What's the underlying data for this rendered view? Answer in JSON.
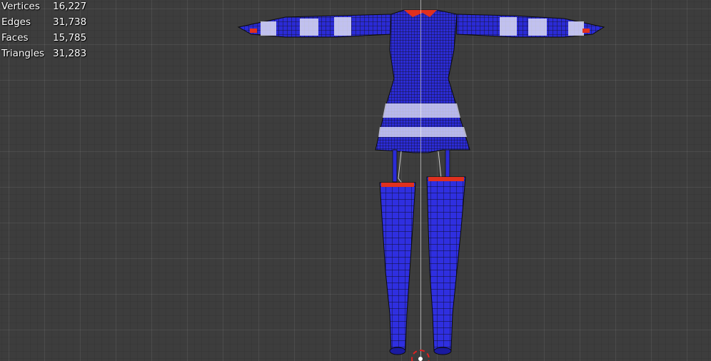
{
  "viewport": {
    "background_color": "#3d3d3d",
    "mesh_color": "#2a2ad8",
    "wire_color": "#111111",
    "highlight_color": "#dcdcf5",
    "accent_color": "#e0301e"
  },
  "statistics": [
    {
      "label": "Vertices",
      "value": "16,227"
    },
    {
      "label": "Edges",
      "value": "31,738"
    },
    {
      "label": "Faces",
      "value": "15,785"
    },
    {
      "label": "Triangles",
      "value": "31,283"
    }
  ],
  "icons": {
    "cursor": "3d-cursor-icon"
  }
}
